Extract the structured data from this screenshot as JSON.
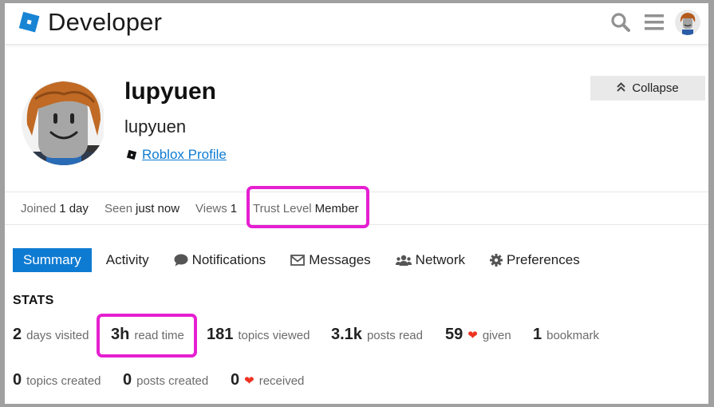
{
  "header": {
    "logo_text": "Developer",
    "icons": [
      "search-icon",
      "hamburger-menu-icon",
      "user-avatar"
    ]
  },
  "profile": {
    "username": "lupyuen",
    "full_name": "lupyuen",
    "roblox_profile_link": "Roblox Profile",
    "collapse_label": "Collapse"
  },
  "meta": {
    "joined_label": "Joined",
    "joined_value": "1 day",
    "seen_label": "Seen",
    "seen_value": "just now",
    "views_label": "Views",
    "views_value": "1",
    "trust_label": "Trust Level",
    "trust_value": "Member"
  },
  "tabs": {
    "summary": "Summary",
    "activity": "Activity",
    "notifications": "Notifications",
    "messages": "Messages",
    "network": "Network",
    "preferences": "Preferences"
  },
  "stats": {
    "title": "STATS",
    "days_visited": {
      "value": "2",
      "label": "days visited"
    },
    "read_time": {
      "value": "3h",
      "label": "read time"
    },
    "topics_viewed": {
      "value": "181",
      "label": "topics viewed"
    },
    "posts_read": {
      "value": "3.1k",
      "label": "posts read"
    },
    "likes_given": {
      "value": "59",
      "label": "given"
    },
    "bookmarks": {
      "value": "1",
      "label": "bookmark"
    },
    "topics_created": {
      "value": "0",
      "label": "topics created"
    },
    "posts_created": {
      "value": "0",
      "label": "posts created"
    },
    "likes_received": {
      "value": "0",
      "label": "received"
    }
  },
  "colors": {
    "accent": "#0e7bd2",
    "highlight": "#e61fd1",
    "heart": "#e32"
  }
}
